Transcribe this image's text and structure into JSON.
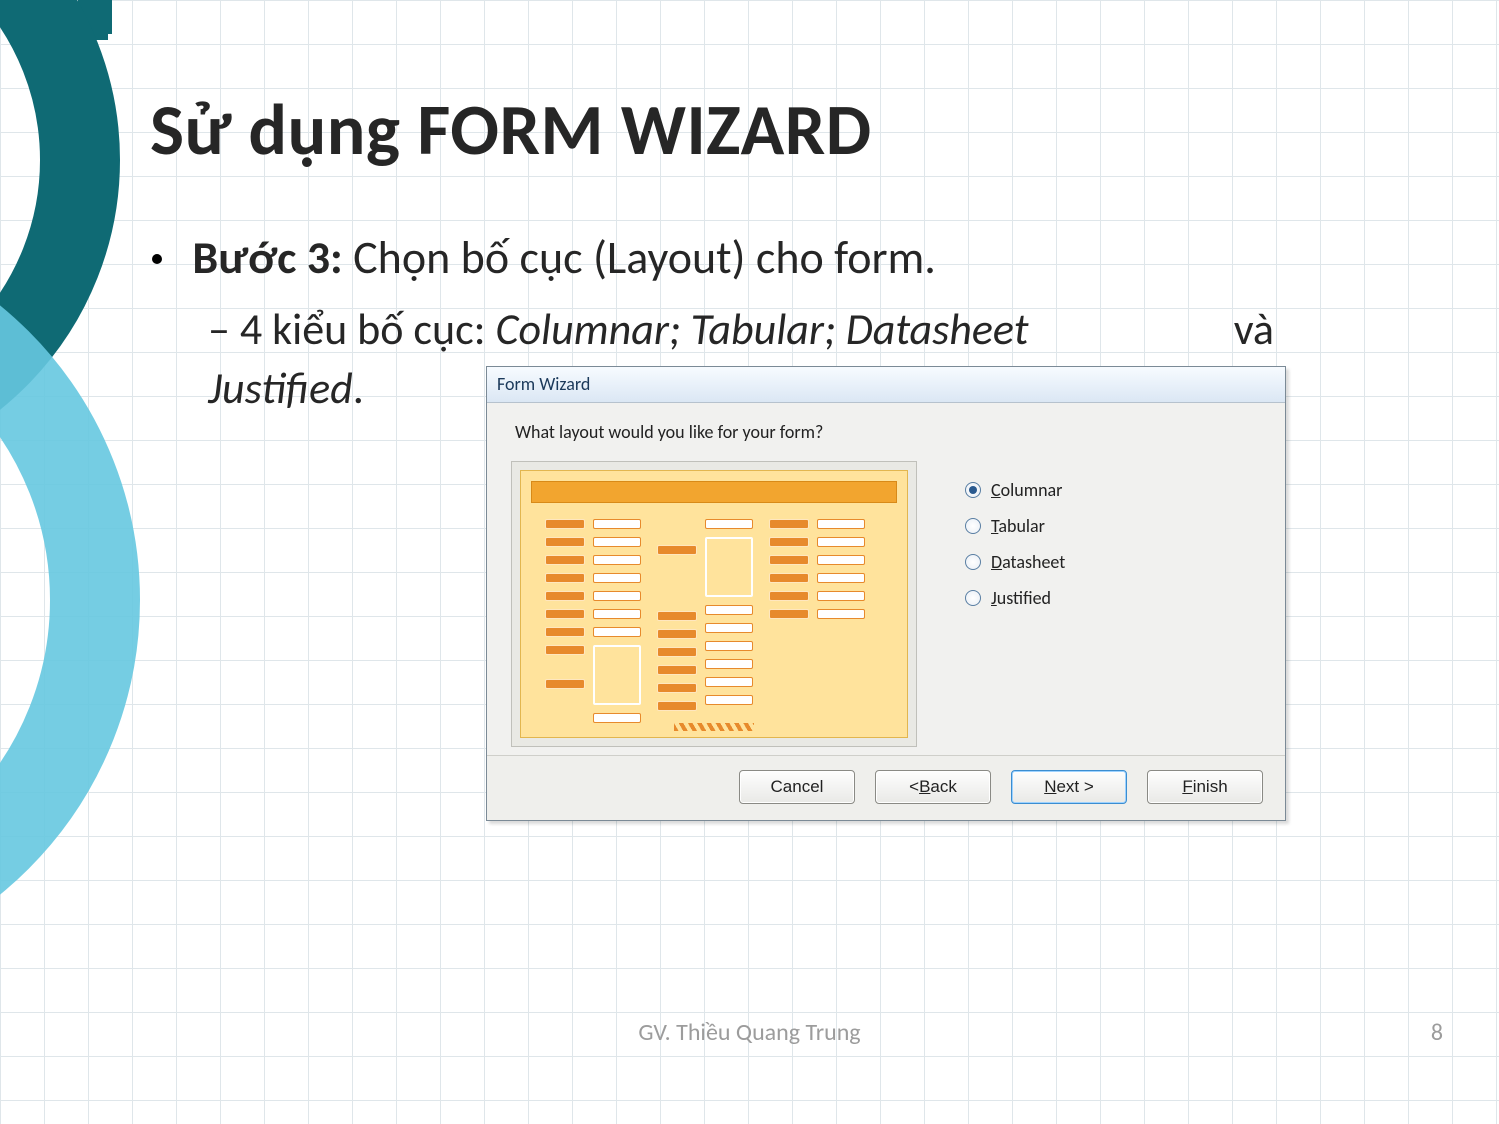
{
  "slide": {
    "title": "Sử dụng FORM WIZARD",
    "bullet_step_label": "Bước 3:",
    "bullet_step_text": " Chọn bố cục (Layout) cho form.",
    "sub_prefix": "– 4  kiểu  bố  cục:  ",
    "sub_italic": "Columnar;  Tabular;  Datasheet",
    "sub_tail_word": "và",
    "sub_italic2": "Justified",
    "sub_period": "."
  },
  "wizard": {
    "title": "Form Wizard",
    "question": "What layout would you like for your form?",
    "options": [
      {
        "label": "Columnar",
        "accelerator": "C",
        "selected": true
      },
      {
        "label": "Tabular",
        "accelerator": "T",
        "selected": false
      },
      {
        "label": "Datasheet",
        "accelerator": "D",
        "selected": false
      },
      {
        "label": "Justified",
        "accelerator": "J",
        "selected": false
      }
    ],
    "buttons": {
      "cancel": "Cancel",
      "back": "< Back",
      "next": "Next >",
      "finish": "Finish"
    }
  },
  "footer": {
    "author": "GV. Thiều Quang Trung",
    "page": "8"
  }
}
